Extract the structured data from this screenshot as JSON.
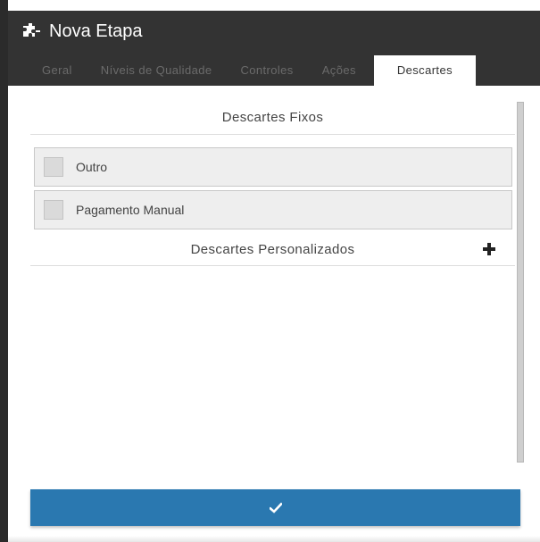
{
  "window": {
    "icon": "puzzle-icon",
    "title": "Nova Etapa"
  },
  "tabs": [
    {
      "label": "Geral",
      "active": false
    },
    {
      "label": "Níveis de Qualidade",
      "active": false
    },
    {
      "label": "Controles",
      "active": false
    },
    {
      "label": "Ações",
      "active": false
    },
    {
      "label": "Descartes",
      "active": true
    }
  ],
  "descartes_fixos": {
    "title": "Descartes Fixos",
    "items": [
      {
        "label": "Outro",
        "checked": false
      },
      {
        "label": "Pagamento Manual",
        "checked": false
      }
    ]
  },
  "descartes_personalizados": {
    "title": "Descartes Personalizados",
    "add_icon": "plus-icon"
  },
  "confirm_button": {
    "icon": "check-icon"
  },
  "colors": {
    "header_bg": "#333333",
    "accent": "#2a78b0"
  }
}
